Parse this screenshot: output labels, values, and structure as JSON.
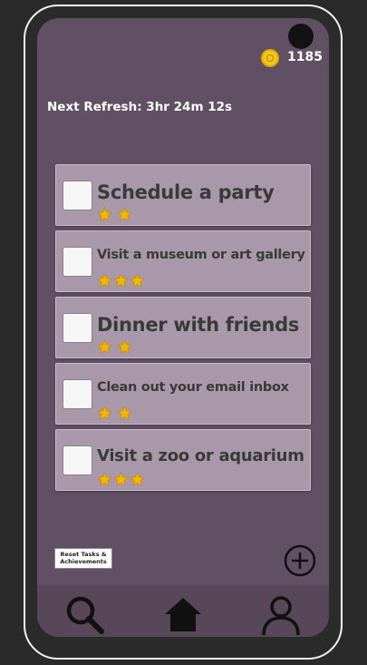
{
  "status": {
    "coin_count": "1185",
    "next_refresh_label": "Next Refresh: 3hr 24m 12s"
  },
  "tasks": [
    {
      "title": "Schedule a party",
      "stars": 2,
      "checked": false
    },
    {
      "title": "Visit a museum or art gallery",
      "stars": 3,
      "checked": false
    },
    {
      "title": "Dinner with friends",
      "stars": 2,
      "checked": false
    },
    {
      "title": "Clean out your email inbox",
      "stars": 2,
      "checked": false
    },
    {
      "title": "Visit a zoo or aquarium",
      "stars": 3,
      "checked": false
    }
  ],
  "actions": {
    "reset_line1": "Reset Tasks &",
    "reset_line2": "Achievements"
  },
  "icons": {
    "coin": "coin-icon",
    "star": "star-icon",
    "add": "plus-circle-icon",
    "nav_search": "search-icon",
    "nav_home": "home-icon",
    "nav_profile": "profile-icon"
  },
  "colors": {
    "screen_bg": "#614f64",
    "card_bg": "#a898a9",
    "navbar_bg": "#574758",
    "star": "#f5b400",
    "coin": "#f5c518"
  }
}
